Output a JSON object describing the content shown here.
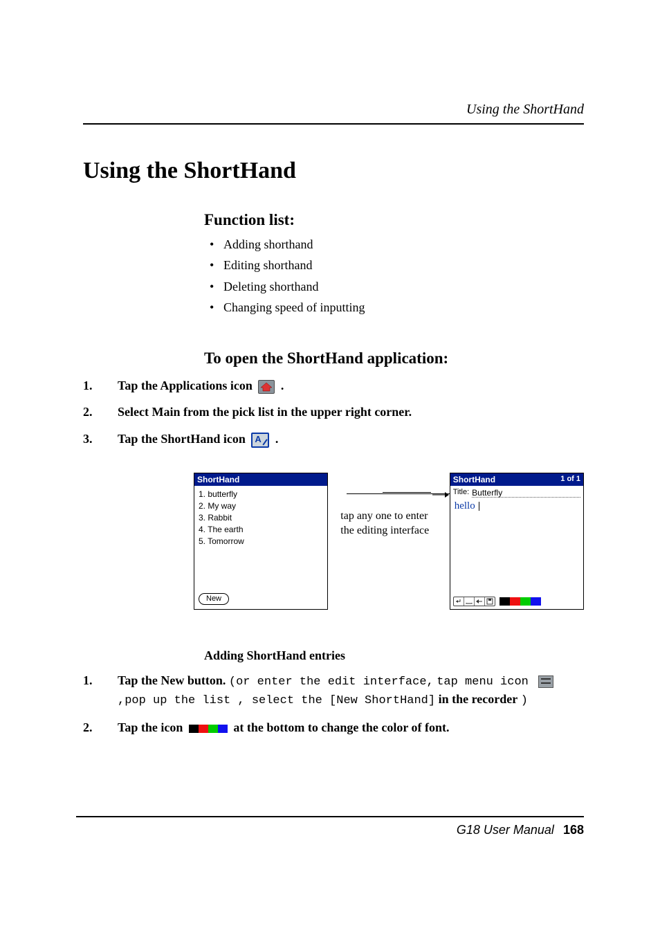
{
  "header": {
    "running": "Using the ShortHand"
  },
  "title": "Using the ShortHand",
  "section_function_list": {
    "heading": "Function list:",
    "items": [
      "Adding shorthand",
      "Editing shorthand",
      "Deleting shorthand",
      "Changing speed of inputting"
    ]
  },
  "section_open_app": {
    "heading": "To open the ShortHand application:",
    "step1_a": "Tap the Applications icon ",
    "step1_b": " .",
    "step2": "Select Main from the pick list in the upper right corner.",
    "step3_a": "Tap the ShortHand icon ",
    "step3_b": " ."
  },
  "screenshots": {
    "left": {
      "title": "ShortHand",
      "items": [
        "1. butterfly",
        "2. My way",
        "3. Rabbit",
        "4. The earth",
        "5. Tomorrow"
      ],
      "new_button": "New"
    },
    "caption": "tap any one to enter the editing interface",
    "right": {
      "title_left": "ShortHand",
      "title_right": "1 of 1",
      "title_label": "Title:",
      "title_value": "Butterfly",
      "written": "hello"
    }
  },
  "section_add": {
    "heading": "Adding ShortHand entries",
    "step1": {
      "bold_a": "Tap the New button.",
      "mono_a": "(or enter the edit interface,",
      "mono_b": "tap menu icon ",
      "mono_c": ",pop up the list , select the [New ShortHand]",
      "bold_b": " in the recorder",
      "tail": ")"
    },
    "step2_a": "Tap the icon",
    "step2_b": "at the bottom to change the color of font."
  },
  "footer": {
    "manual": "G18 User Manual",
    "page": "168"
  }
}
